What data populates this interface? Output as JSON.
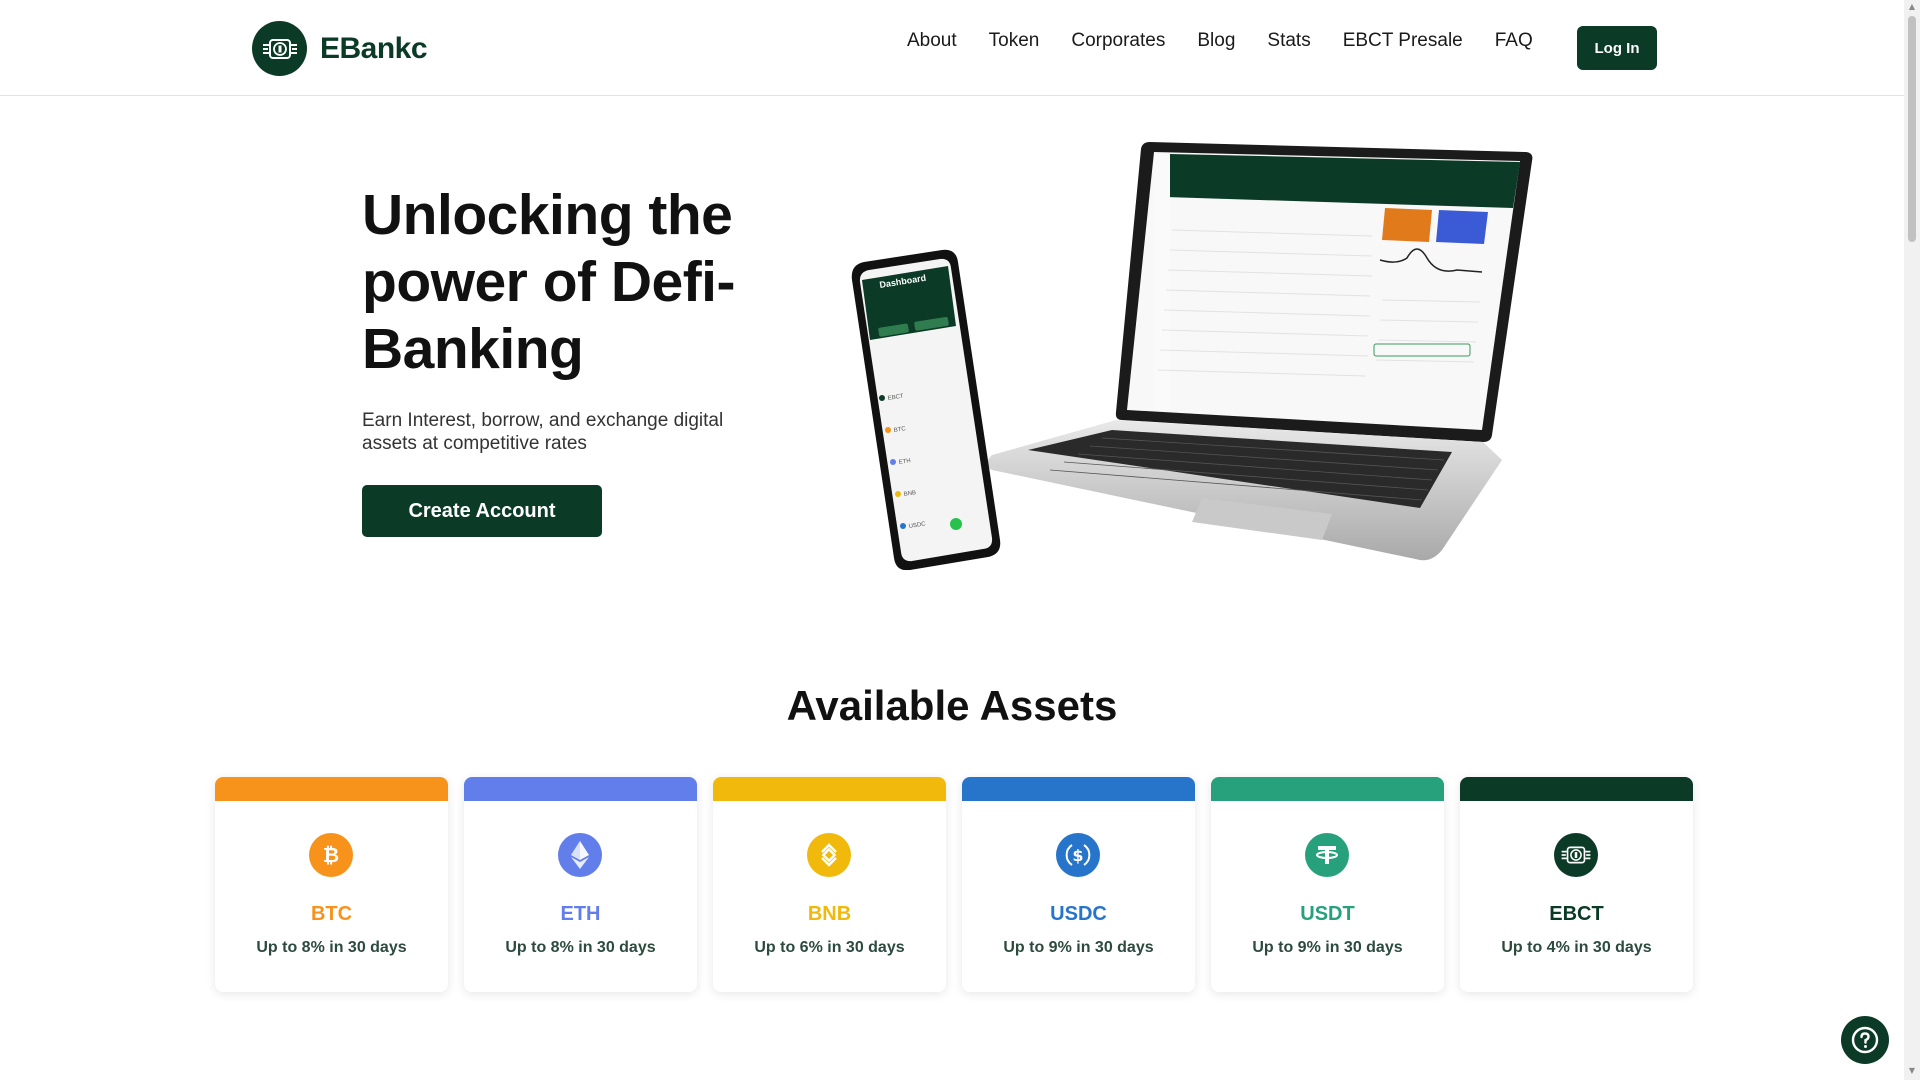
{
  "header": {
    "brand": "EBankc",
    "nav": [
      "About",
      "Token",
      "Corporates",
      "Blog",
      "Stats",
      "EBCT Presale",
      "FAQ"
    ],
    "login_label": "Log In"
  },
  "hero": {
    "title": "Unlocking the power of Defi-Banking",
    "subtitle": "Earn Interest, borrow, and exchange digital assets at competitive rates",
    "cta_label": "Create Account",
    "dashboard_heading": "Dashboard",
    "dashboard_items": [
      "EBCT",
      "BTC",
      "ETH",
      "BNB",
      "USDC"
    ]
  },
  "assets": {
    "title": "Available Assets",
    "items": [
      {
        "name": "BTC",
        "rate": "Up to 8% in 30 days",
        "color": "#f7931a",
        "icon": "bitcoin-icon"
      },
      {
        "name": "ETH",
        "rate": "Up to 8% in 30 days",
        "color": "#627eea",
        "icon": "ethereum-icon"
      },
      {
        "name": "BNB",
        "rate": "Up to 6% in 30 days",
        "color": "#f0b90b",
        "icon": "bnb-icon"
      },
      {
        "name": "USDC",
        "rate": "Up to 9% in 30 days",
        "color": "#2775ca",
        "icon": "usdc-icon"
      },
      {
        "name": "USDT",
        "rate": "Up to 9% in 30 days",
        "color": "#26a17b",
        "icon": "tether-icon"
      },
      {
        "name": "EBCT",
        "rate": "Up to 4% in 30 days",
        "color": "#0b3a26",
        "icon": "ebct-icon"
      }
    ]
  },
  "colors": {
    "brand": "#0b3a26",
    "text": "#111111"
  }
}
